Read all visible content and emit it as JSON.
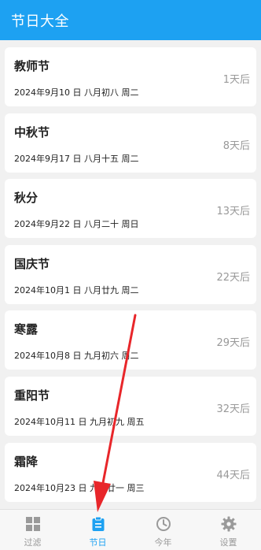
{
  "app_bar": {
    "title": "节日大全"
  },
  "festivals": [
    {
      "name": "教师节",
      "date": "2024年9月10 日  八月初八 周二",
      "days": "1天后"
    },
    {
      "name": "中秋节",
      "date": "2024年9月17 日  八月十五 周二",
      "days": "8天后"
    },
    {
      "name": "秋分",
      "date": "2024年9月22 日  八月二十 周日",
      "days": "13天后"
    },
    {
      "name": "国庆节",
      "date": "2024年10月1 日  八月廿九 周二",
      "days": "22天后"
    },
    {
      "name": "寒露",
      "date": "2024年10月8 日  九月初六 周二",
      "days": "29天后"
    },
    {
      "name": "重阳节",
      "date": "2024年10月11 日  九月初九 周五",
      "days": "32天后"
    },
    {
      "name": "霜降",
      "date": "2024年10月23 日  九月廿一 周三",
      "days": "44天后"
    }
  ],
  "bottom_nav": [
    {
      "label": "过滤",
      "icon": "grid-icon",
      "active": false
    },
    {
      "label": "节日",
      "icon": "clipboard-icon",
      "active": true
    },
    {
      "label": "今年",
      "icon": "clock-icon",
      "active": false
    },
    {
      "label": "设置",
      "icon": "gear-icon",
      "active": false
    }
  ],
  "colors": {
    "accent": "#1da1f2",
    "background": "#f1f1f1",
    "inactive": "#9a9a9a",
    "arrow": "#e8262a"
  }
}
